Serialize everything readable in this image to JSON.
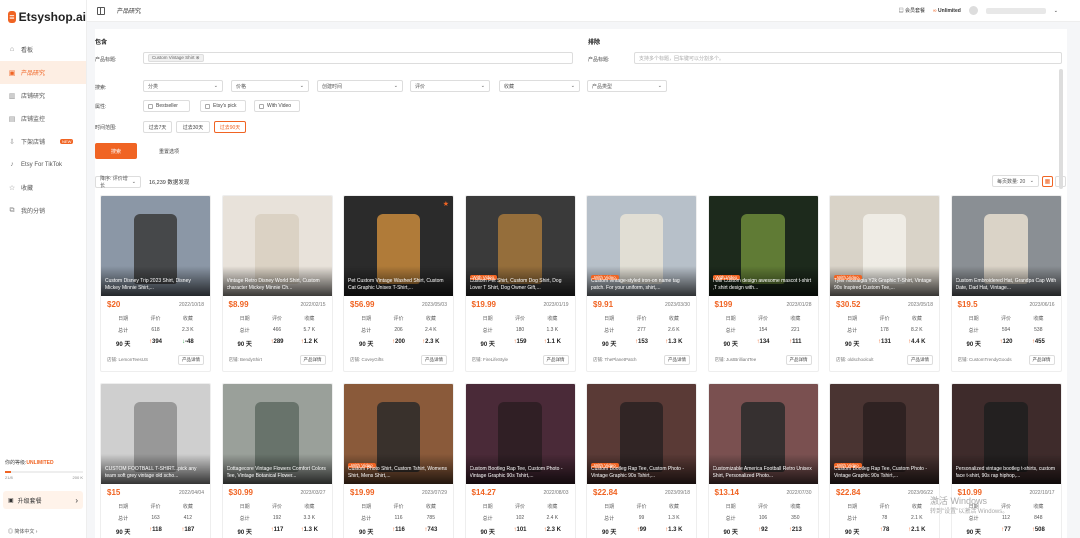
{
  "app": {
    "logo_text": "Etsyshop.ai",
    "page_title": "产品研究"
  },
  "sidebar": {
    "items": [
      {
        "icon": "home-icon",
        "label": "看板"
      },
      {
        "icon": "box-icon",
        "label": "产品研究",
        "active": true
      },
      {
        "icon": "shop-icon",
        "label": "店铺研究"
      },
      {
        "icon": "monitor-icon",
        "label": "店铺监控"
      },
      {
        "icon": "download-icon",
        "label": "下架店铺",
        "badge": "NEW"
      },
      {
        "icon": "tiktok-icon",
        "label": "Etsy For TikTok"
      },
      {
        "icon": "star-icon",
        "label": "收藏"
      },
      {
        "icon": "share-icon",
        "label": "我的分销"
      }
    ]
  },
  "plan": {
    "prefix": "你的等级:",
    "level": "UNLIMITED",
    "used": "21/8",
    "total": "200 K",
    "progress": 0.08
  },
  "upgrade_label": "升级套餐",
  "lang_label": "简体中文",
  "header": {
    "member_label": "会员套餐",
    "unlimited_label": "Unlimited"
  },
  "filters": {
    "include_title": "包含",
    "exclude_title": "排除",
    "product_title_label": "产品标题:",
    "include_tag": "Custom Vintage Shirt",
    "exclude_placeholder": "支持多个标题，回车键可以分割多个。",
    "search_label": "搜索:",
    "selects": [
      "分类",
      "价格",
      "创建时间",
      "评价",
      "收藏",
      "产品类型"
    ],
    "attr_label": "属性:",
    "attrs": [
      "Bestseller",
      "Etsy's pick",
      "With Video"
    ],
    "time_label": "时间范围:",
    "times": [
      "过去7天",
      "过去30天",
      "过去90天"
    ],
    "active_time": 2,
    "search_btn": "搜索",
    "reset_btn": "重置选项"
  },
  "list": {
    "sort": "降序: 评价增长",
    "count": "16,239 数据发现",
    "per_page": "每页数量: 20"
  },
  "card_labels": {
    "h_date": "日期",
    "h_review": "评价",
    "h_fav": "收藏",
    "total": "总计",
    "days": "90 天",
    "shop_prefix": "店铺:",
    "detail": "产品详情"
  },
  "products": [
    {
      "title": "Custom Disney Trip 2023 Shirt, Disney Mickey Minnie Shirt,...",
      "price": "$20",
      "date": "2022/10/18",
      "rev_total": "618",
      "fav_total": "2.3 K",
      "rev_90": "394",
      "fav_90": "-48",
      "shop": "LemonTeesUS",
      "video": false,
      "bg": "#8b97a6",
      "fg": "#3a3a3a"
    },
    {
      "title": "Vintage Retro Disney World Shirt, Custom character Mickey Minnie Ch...",
      "price": "$8.99",
      "date": "2022/02/15",
      "rev_total": "466",
      "fav_total": "5.7 K",
      "rev_90": "289",
      "fav_90": "1.2 K",
      "shop": "BendyShirt",
      "video": false,
      "bg": "#e8e2da",
      "fg": "#d8cfc0"
    },
    {
      "title": "Pet Custom Vintage Washed Shirt, Custom Cat Graphic Unisex T-Shirt,...",
      "price": "$56.99",
      "date": "2023/05/03",
      "rev_total": "206",
      "fav_total": "2.4 K",
      "rev_90": "200",
      "fav_90": "2.3 K",
      "shop": "CoveyGifts",
      "video": false,
      "star": true,
      "bg": "#2b2b2b",
      "fg": "#c88a3c"
    },
    {
      "title": "Custom Pet Shirt, Custom Dog Shirt, Dog Lover T Shirt, Dog Owner Gift,...",
      "price": "$19.99",
      "date": "2023/01/19",
      "rev_total": "180",
      "fav_total": "1.3 K",
      "rev_90": "159",
      "fav_90": "1.1 K",
      "shop": "FireLifeStyle",
      "video": true,
      "bg": "#3a3a3a",
      "fg": "#a6783c"
    },
    {
      "title": "Custom vintage-styled iron-on name tag patch. For your uniform, shirt,...",
      "price": "$9.91",
      "date": "2023/03/30",
      "rev_total": "277",
      "fav_total": "2.6 K",
      "rev_90": "153",
      "fav_90": "1.3 K",
      "shop": "ThePlanetPatch",
      "video": true,
      "bg": "#b7c0c9",
      "fg": "#e9e3d6"
    },
    {
      "title": "I will Custom design awesome mascot t-shirt ,T shirt design with...",
      "price": "$199",
      "date": "2023/01/28",
      "rev_total": "154",
      "fav_total": "221",
      "rev_90": "134",
      "fav_90": "111",
      "shop": "JustBrilliantTee",
      "video": true,
      "bg": "#1d2a1c",
      "fg": "#6c8a3a"
    },
    {
      "title": "Tyler Nostalgia Y2k Graphic T-Shirt, Vintage 90s Inspired Custom Tee,...",
      "price": "$30.52",
      "date": "2023/05/18",
      "rev_total": "178",
      "fav_total": "8.2 K",
      "rev_90": "131",
      "fav_90": "4.4 K",
      "shop": "oldschoolcult",
      "video": true,
      "bg": "#d9d3c8",
      "fg": "#f2f0ea"
    },
    {
      "title": "Custom Embroidered Hat, Grandpa Cap With Date, Dad Hat, Vintage...",
      "price": "$19.5",
      "date": "2023/06/16",
      "rev_total": "594",
      "fav_total": "538",
      "rev_90": "120",
      "fav_90": "455",
      "shop": "CustomTrendyGoods",
      "video": false,
      "bg": "#8a8f94",
      "fg": "#e7dfd0"
    },
    {
      "title": "CUSTOM FOOTBALL T-SHIRT...pick any team soft grey vintage old scho...",
      "price": "$15",
      "date": "2022/04/04",
      "rev_total": "163",
      "fav_total": "412",
      "rev_90": "118",
      "fav_90": "187",
      "shop": "",
      "video": false,
      "bg": "#cfcfcf",
      "fg": "#8e8e8e"
    },
    {
      "title": "Cottagecore Vintage Flowers Comfort Colors Tee, Vintage Botanical Flower...",
      "price": "$30.99",
      "date": "2023/03/27",
      "rev_total": "192",
      "fav_total": "3.3 K",
      "rev_90": "117",
      "fav_90": "1.3 K",
      "shop": "",
      "video": false,
      "bg": "#9aa09a",
      "fg": "#5f6b63"
    },
    {
      "title": "Custom Photo Shirt, Custom Tshirt, Womens Shirt, Mens Shirt,...",
      "price": "$19.99",
      "date": "2023/07/29",
      "rev_total": "116",
      "fav_total": "785",
      "rev_90": "116",
      "fav_90": "743",
      "shop": "",
      "video": true,
      "bg": "#8a5a3a",
      "fg": "#2a2a2a"
    },
    {
      "title": "Custom Bootleg Rap Tee, Custom Photo - Vintage Graphic 90s Tshirt,...",
      "price": "$14.27",
      "date": "2022/08/03",
      "rev_total": "102",
      "fav_total": "2.4 K",
      "rev_90": "101",
      "fav_90": "2.3 K",
      "shop": "",
      "video": false,
      "bg": "#4a2a38",
      "fg": "#2b1d22"
    },
    {
      "title": "Custom Bootleg Rap Tee, Custom Photo - Vintage Graphic 90s Tshirt,...",
      "price": "$22.84",
      "date": "2023/09/18",
      "rev_total": "99",
      "fav_total": "1.3 K",
      "rev_90": "99",
      "fav_90": "1.3 K",
      "shop": "",
      "video": true,
      "bg": "#5a3a36",
      "fg": "#2a2222"
    },
    {
      "title": "Customizable America Football Retro Unisex Shirt, Personalized Photo...",
      "price": "$13.14",
      "date": "2022/07/30",
      "rev_total": "106",
      "fav_total": "350",
      "rev_90": "92",
      "fav_90": "213",
      "shop": "",
      "video": false,
      "bg": "#7a5050",
      "fg": "#2a2a2a"
    },
    {
      "title": "Custom Bootleg Rap Tee, Custom Photo - Vintage Graphic 90s Tshirt,...",
      "price": "$22.84",
      "date": "2023/06/22",
      "rev_total": "78",
      "fav_total": "2.1 K",
      "rev_90": "78",
      "fav_90": "2.1 K",
      "shop": "",
      "video": true,
      "bg": "#4a3432",
      "fg": "#2a2020"
    },
    {
      "title": "Personalized vintage bootleg t-shirts, custom face t-shirt, 90s rap hiphop,...",
      "price": "$10.99",
      "date": "2022/10/17",
      "rev_total": "112",
      "fav_total": "848",
      "rev_90": "77",
      "fav_90": "508",
      "shop": "",
      "video": false,
      "bg": "#3e2b2b",
      "fg": "#1f1f1f"
    }
  ],
  "watermark": {
    "line1": "激活 Windows",
    "line2": "转到\"设置\"以激活 Windows。"
  }
}
